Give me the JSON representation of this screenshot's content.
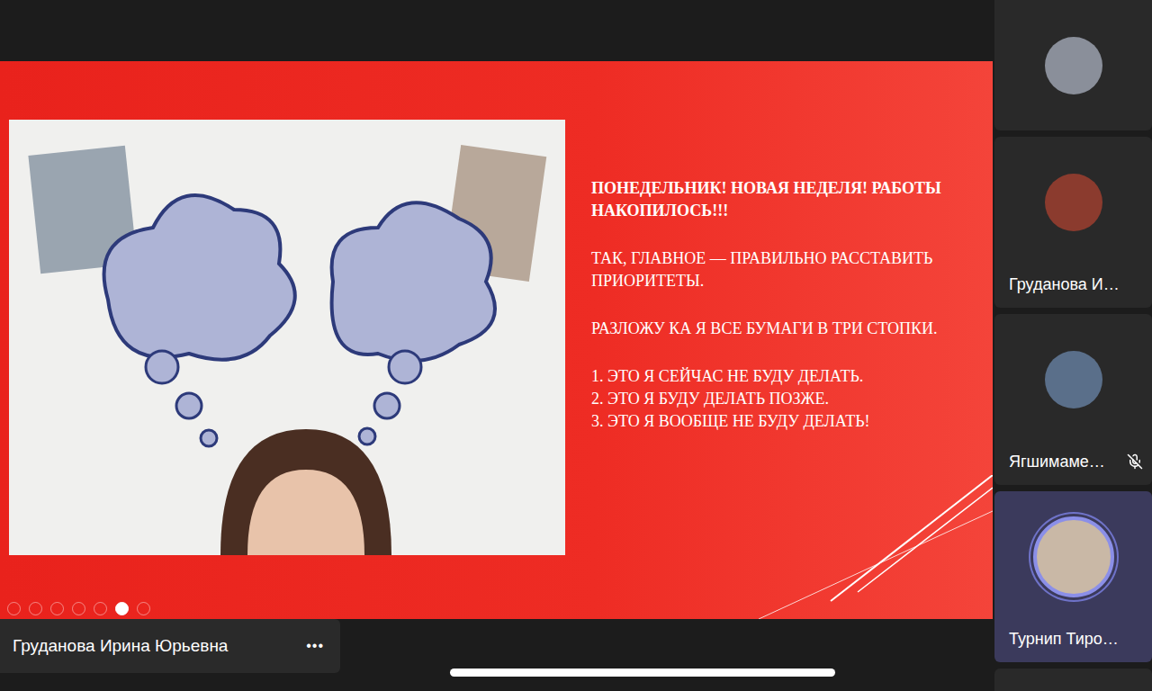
{
  "presentation": {
    "heading": "ПОНЕДЕЛЬНИК! НОВАЯ НЕДЕЛЯ! РАБОТЫ НАКОПИЛОСЬ!!!",
    "paragraphs": [
      "ТАК, ГЛАВНОЕ — ПРАВИЛЬНО РАССТАВИТЬ ПРИОРИТЕТЫ.",
      "РАЗЛОЖУ КА Я ВСЕ БУМАГИ В ТРИ СТОПКИ."
    ],
    "list": [
      "1. ЭТО Я СЕЙЧАС НЕ БУДУ ДЕЛАТЬ.",
      "2. ЭТО Я БУДУ ДЕЛАТЬ ПОЗЖЕ.",
      "3. ЭТО Я ВООБЩЕ НЕ БУДУ ДЕЛАТЬ!"
    ],
    "nav": [
      {
        "selected": false
      },
      {
        "selected": false
      },
      {
        "selected": false
      },
      {
        "selected": false
      },
      {
        "selected": false
      },
      {
        "selected": true
      },
      {
        "selected": false
      }
    ]
  },
  "presenter": {
    "name": "Груданова Ирина Юрьевна",
    "more": "•••"
  },
  "participants": [
    {
      "name": "",
      "muted": false,
      "speaking": false,
      "color": "#8a8f9a"
    },
    {
      "name": "Груданова И…",
      "muted": false,
      "speaking": false,
      "color": "#8b3b2e"
    },
    {
      "name": "Ягшимаме…",
      "muted": true,
      "speaking": false,
      "color": "#5a6f8a"
    },
    {
      "name": "Турнип Тиро…",
      "muted": false,
      "speaking": true,
      "color": "#c9b8a6"
    }
  ]
}
